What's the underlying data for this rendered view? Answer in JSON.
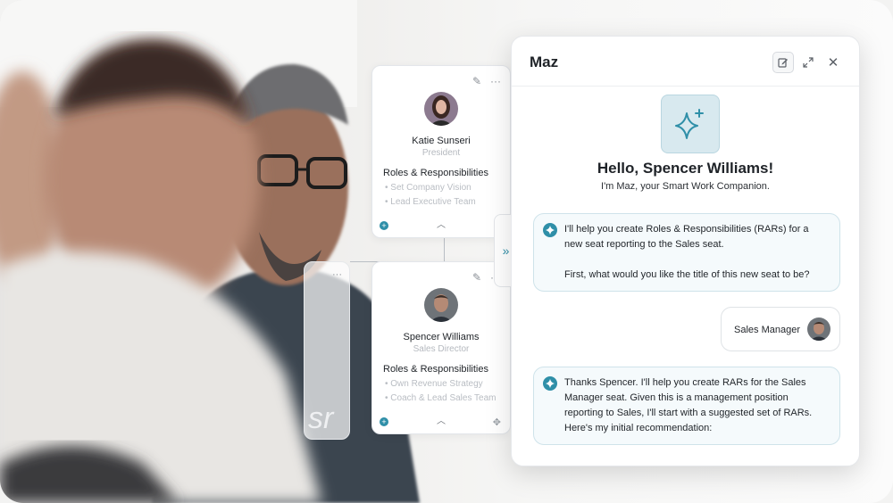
{
  "panel": {
    "title": "Maz",
    "greeting": "Hello, Spencer Williams!",
    "subgreeting": "I'm Maz, your Smart Work Companion.",
    "messages": [
      {
        "sender": "bot",
        "line1": "I'll help you create Roles & Responsibilities (RARs) for a new seat reporting to the Sales seat.",
        "line2": "First, what would you like the title of this new seat to be?"
      },
      {
        "sender": "user",
        "text": "Sales Manager"
      },
      {
        "sender": "bot",
        "text": "Thanks Spencer. I'll help you create RARs for the Sales Manager seat. Given this is a management position reporting to Sales, I'll start with a suggested set of RARs. Here's my initial recommendation:"
      }
    ],
    "icons": {
      "edit": "edit-icon",
      "expand": "expand-icon",
      "close": "close-icon",
      "sparkle": "sparkle-icon"
    }
  },
  "org_chart": {
    "cards": [
      {
        "name": "Katie Sunseri",
        "title": "President",
        "rr_heading": "Roles & Responsibilities",
        "items": [
          "Set Company Vision",
          "Lead Executive Team"
        ]
      },
      {
        "name": "Spencer Williams",
        "title": "Sales Director",
        "rr_heading": "Roles & Responsibilities",
        "items": [
          "Own Revenue Strategy",
          "Coach & Lead Sales Team"
        ]
      }
    ]
  },
  "colors": {
    "accent": "#2f8fa8",
    "bubble_bg": "#f5fafc",
    "bubble_border": "#cfe3ea",
    "sparkle_bg": "#d8e9ef"
  }
}
